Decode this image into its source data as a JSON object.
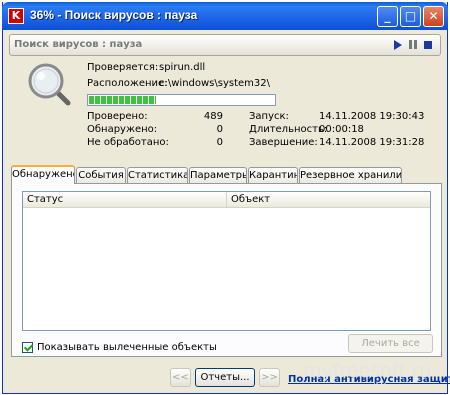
{
  "window": {
    "title": "36% - Поиск вирусов : пауза",
    "app_icon_letter": "K"
  },
  "header": {
    "subtitle": "Поиск вирусов : пауза"
  },
  "scan": {
    "checking_label": "Проверяется:",
    "checking_value": "spirun.dll",
    "location_label": "Расположение:",
    "location_value": "c:\\windows\\system32\\",
    "progress_percent": 36
  },
  "stats": {
    "checked_label": "Проверено:",
    "checked_value": "489",
    "found_label": "Обнаружено:",
    "found_value": "0",
    "unprocessed_label": "Не обработано:",
    "unprocessed_value": "0",
    "start_label": "Запуск:",
    "start_value": "14.11.2008 19:30:43",
    "duration_label": "Длительность:",
    "duration_value": "00:00:18",
    "end_label": "Завершение:",
    "end_value": "14.11.2008 19:31:28"
  },
  "tabs": [
    "Обнаружено",
    "События",
    "Статистика",
    "Параметры",
    "Карантин",
    "Резервное хранилище"
  ],
  "table": {
    "columns": [
      "Статус",
      "Объект"
    ]
  },
  "panel": {
    "show_cured_label": "Показывать вылеченные объекты",
    "cure_all_label": "Лечить все"
  },
  "footer": {
    "back_label": "<<",
    "reports_label": "Отчеты...",
    "forward_label": ">>",
    "link_label": "Полная антивирусная защита"
  },
  "watermark": "myfreesoft.ru"
}
